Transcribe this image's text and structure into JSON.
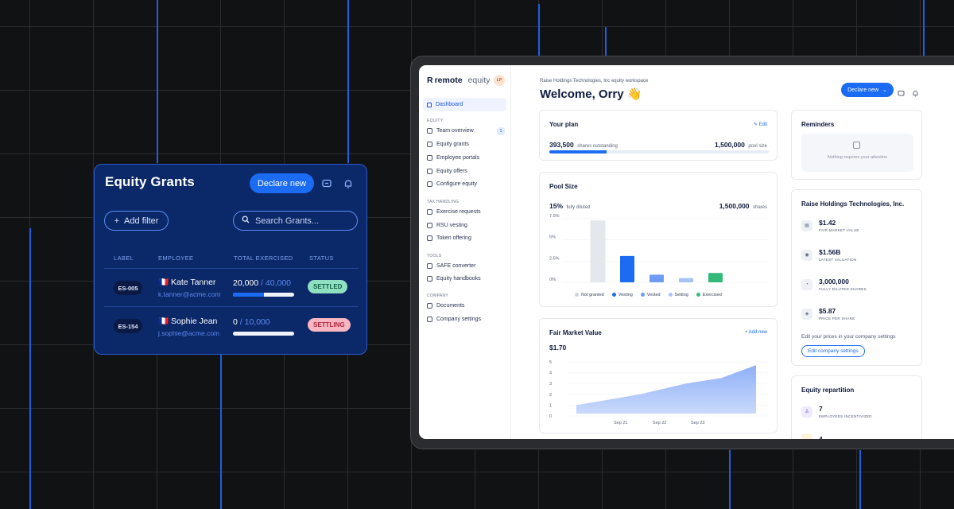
{
  "grants_card": {
    "title": "Equity Grants",
    "declare_label": "Declare new",
    "add_filter_label": "Add filter",
    "search_placeholder": "Search Grants...",
    "columns": [
      "LABEL",
      "EMPLOYEE",
      "TOTAL EXERCISED",
      "STATUS"
    ],
    "rows": [
      {
        "label": "ES-005",
        "flag": "🇫🇷",
        "name": "Kate Tanner",
        "email": "k.tanner@acme.com",
        "exercised": "20,000",
        "total": "40,000",
        "progress": 0.5,
        "status": "SETTLED"
      },
      {
        "label": "ES-154",
        "flag": "🇫🇷",
        "name": "Sophie Jean",
        "email": "j.sophie@acme.com",
        "exercised": "0",
        "total": "10,000",
        "progress": 0,
        "status": "SETTLING"
      }
    ]
  },
  "app": {
    "logo_brand": "remote",
    "logo_suffix": "equity",
    "avatar_initials": "LP",
    "workspace": "Raise Holdings Technologies, Inc equity workspace",
    "welcome": "Welcome, Orry 👋",
    "declare_label": "Declare new",
    "sidebar": {
      "dashboard": "Dashboard",
      "section_equity": "EQUITY",
      "equity_items": [
        "Team overview",
        "Equity grants",
        "Employee portals",
        "Equity offers",
        "Configure equity"
      ],
      "team_badge": "1",
      "section_tax": "TAX HANDLING",
      "tax_items": [
        "Exercise requests",
        "RSU vesting",
        "Token offering"
      ],
      "section_tools": "TOOLS",
      "tools_items": [
        "SAFE converter",
        "Equity handbooks"
      ],
      "section_company": "COMPANY",
      "company_items": [
        "Documents",
        "Company settings"
      ]
    },
    "your_plan": {
      "title": "Your plan",
      "edit_label": "Edit",
      "outstanding_value": "393,500",
      "outstanding_label": "shares outstanding",
      "pool_value": "1,500,000",
      "pool_label": "pool size",
      "progress": 0.262
    },
    "pool_size": {
      "title": "Pool Size",
      "diluted_value": "15%",
      "diluted_label": "fully diluted",
      "shares_value": "1,500,000",
      "shares_label": "shares"
    },
    "fair_market_value": {
      "title": "Fair Market Value",
      "add_label": "+ Add new",
      "value": "$1.70"
    },
    "reminders": {
      "title": "Reminders",
      "empty_text": "Nothing requires your attention"
    },
    "company_card": {
      "title": "Raise Holdings Technologies, Inc.",
      "stats": [
        {
          "value": "$1.42",
          "label": "FAIR MARKET VALUE",
          "icon": "building-icon"
        },
        {
          "value": "$1.56B",
          "label": "LATEST VALUATION",
          "icon": "coins-icon"
        },
        {
          "value": "3,000,000",
          "label": "FULLY DILUTED SHARES",
          "icon": "pie-icon"
        },
        {
          "value": "$5.87",
          "label": "PRICE PER SHARE",
          "icon": "tag-icon"
        }
      ],
      "settings_note": "Edit your prices in your company settings",
      "settings_button": "Edit company settings"
    },
    "equity_repartition": {
      "title": "Equity repartition",
      "employees_value": "7",
      "employees_label": "EMPLOYEES INCENTIVIZED",
      "next_value": "4"
    }
  },
  "chart_data": [
    {
      "type": "bar",
      "title": "Pool Size",
      "categories": [
        "Not granted",
        "Vesting",
        "Vested",
        "Setting",
        "Exercised"
      ],
      "values": [
        7.3,
        3.1,
        0.9,
        0.5,
        1.1
      ],
      "yticks": [
        "0%",
        "2.5%",
        "5%",
        "7.5%"
      ],
      "ylim": [
        0,
        7.5
      ],
      "colors": [
        "#e4e7ec",
        "#1b6cf2",
        "#6e9cf5",
        "#a9c3f7",
        "#33b97a"
      ]
    },
    {
      "type": "area",
      "title": "Fair Market Value",
      "x": [
        "",
        "Sep 21",
        "Sep 22",
        "Sep 23",
        ""
      ],
      "values": [
        1.0,
        2.0,
        3.0,
        3.5,
        4.7
      ],
      "yticks": [
        "0",
        "1",
        "2",
        "3",
        "4",
        "5"
      ],
      "ylim": [
        0,
        5
      ]
    }
  ]
}
